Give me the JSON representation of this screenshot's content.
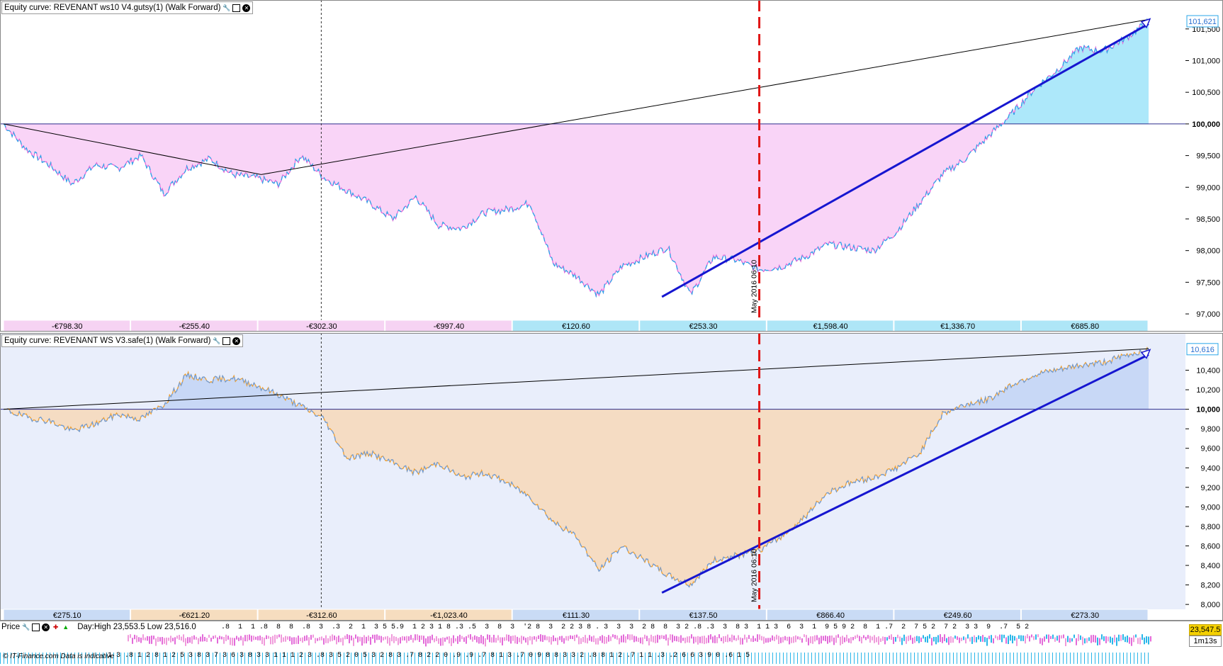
{
  "colors": {
    "upper_pos_fill": "#ade8fa",
    "upper_neg_fill": "#f9d4f7",
    "upper_line": "#2aa7e9",
    "upper_line_neg": "#e36ad9",
    "lower_pos_fill": "#c8d8f6",
    "lower_neg_fill": "#f5dcc3",
    "lower_line": "#6b9cdc",
    "lower_line_neg": "#f0a030",
    "trend_blue": "#1616d0",
    "vline_red": "#e01515",
    "panel_bg": "#ffffff",
    "lower_panel_bg": "#e9eefb"
  },
  "upper_panel": {
    "title": "Equity curve: REVENANT ws10 V4.gutsy(1) (Walk Forward)",
    "icons": [
      "wrench-icon",
      "window-icon",
      "close-icon"
    ],
    "date_label": "May 2016 06:10",
    "current_value_badge": "101,621",
    "segments": [
      {
        "label": "-€798.30",
        "sign": "neg"
      },
      {
        "label": "-€255.40",
        "sign": "neg"
      },
      {
        "label": "-€302.30",
        "sign": "neg"
      },
      {
        "label": "-€997.40",
        "sign": "neg"
      },
      {
        "label": "€120.60",
        "sign": "pos"
      },
      {
        "label": "€253.30",
        "sign": "pos"
      },
      {
        "label": "€1,598.40",
        "sign": "pos"
      },
      {
        "label": "€1,336.70",
        "sign": "pos"
      },
      {
        "label": "€685.80",
        "sign": "pos"
      }
    ]
  },
  "lower_panel": {
    "title": "Equity curve: REVENANT WS V3.safe(1) (Walk Forward)",
    "icons": [
      "wrench-icon",
      "window-icon",
      "close-icon"
    ],
    "date_label": "May 2016 06:10",
    "current_value_badge": "10,616",
    "segments": [
      {
        "label": "€275.10",
        "sign": "pos"
      },
      {
        "label": "-€621.20",
        "sign": "neg"
      },
      {
        "label": "-€312.60",
        "sign": "neg"
      },
      {
        "label": "-€1,023.40",
        "sign": "neg"
      },
      {
        "label": "€111.30",
        "sign": "pos"
      },
      {
        "label": "€137.50",
        "sign": "pos"
      },
      {
        "label": "€866.40",
        "sign": "pos"
      },
      {
        "label": "€249.60",
        "sign": "pos"
      },
      {
        "label": "€273.30",
        "sign": "pos"
      }
    ]
  },
  "price_strip": {
    "label": "Price",
    "info": "Day:High 23,553.5 Low 23,516.0",
    "price": "23,547.5",
    "timer": "1m13s",
    "copyright": "© IT-Finance.com Data is indicative",
    "ticks_row1": "  .8  1  1 .8  8  8  .8  3  .3  2  1  3 5 5.9  1 2 3 1 8 .3 .5  3  8  3  '2 8  3  2 2 3 8 . 3  3  3  2 8  8  3 2 .8 .3  3  8 3  1 1 3  6  3  1  9 5 9 2  8  1 .7  2  7 5 2  7 2  3 3  9  .7  5 2",
    "ticks_row2": "  1 3 .8 1 2 8 1 2 5 3 8 3 7 3 6 3 8 3 3 1 1 1 2 3 .8 3 5 2 0 5 3 2 8 3 .7 8 2 2 0 .9 .9 .7 8 1 3 .7 0 9 8 8 3 3 2 .8 8 1 2 .7 1 1 .3 .2 6 6 3 9 0 .6 1 5"
  },
  "chart_data": [
    {
      "type": "area",
      "title": "Equity curve: REVENANT ws10 V4.gutsy(1) (Walk Forward)",
      "baseline": 100000,
      "ylim": [
        96900,
        101800
      ],
      "y_ticks": [
        97000,
        97500,
        98000,
        98500,
        99000,
        99500,
        100000,
        100500,
        101000,
        101500
      ],
      "y_tick_labels": [
        "97,000",
        "97,500",
        "98,000",
        "98,500",
        "99,000",
        "99,500",
        "100,000",
        "100,500",
        "101,000",
        "101,500"
      ],
      "last_value": 101621,
      "x": [
        0,
        2,
        4,
        6,
        8,
        10,
        12,
        14,
        16,
        18,
        20,
        22,
        24,
        26,
        28,
        30,
        32,
        34,
        36,
        38,
        40,
        42,
        44,
        46,
        48,
        50,
        52,
        54,
        56,
        58,
        60,
        62,
        64,
        66,
        68,
        70,
        72,
        74,
        76,
        78,
        80,
        82,
        84,
        86,
        88,
        90,
        92,
        94,
        96,
        98,
        100
      ],
      "values": [
        100000,
        99600,
        99350,
        99050,
        99350,
        99300,
        99500,
        98900,
        99300,
        99450,
        99200,
        99150,
        99050,
        99500,
        99150,
        98950,
        98750,
        98500,
        98850,
        98400,
        98350,
        98600,
        98650,
        98750,
        97800,
        97600,
        97300,
        97750,
        97900,
        98050,
        97300,
        97900,
        97850,
        97700,
        97750,
        97900,
        98100,
        98050,
        98000,
        98300,
        98750,
        99200,
        99450,
        99800,
        100150,
        100550,
        100850,
        101200,
        101150,
        101350,
        101621
      ],
      "trend_lines": [
        {
          "color": "black",
          "from": [
            0,
            100000
          ],
          "to": [
            22.5,
            99200
          ]
        },
        {
          "color": "black",
          "from": [
            22.5,
            99200
          ],
          "to": [
            100,
            101650
          ]
        },
        {
          "color": "blue",
          "from": [
            57.5,
            97270
          ],
          "to": [
            100,
            101580
          ]
        }
      ],
      "vertical_marker_x": 66
    },
    {
      "type": "area",
      "title": "Equity curve: REVENANT WS V3.safe(1) (Walk Forward)",
      "baseline": 10000,
      "ylim": [
        7950,
        10680
      ],
      "y_ticks": [
        8000,
        8200,
        8400,
        8600,
        8800,
        9000,
        9200,
        9400,
        9600,
        9800,
        10000,
        10200,
        10400
      ],
      "y_tick_labels": [
        "8,000",
        "8,200",
        "8,400",
        "8,600",
        "8,800",
        "9,000",
        "9,200",
        "9,400",
        "9,600",
        "9,800",
        "10,000",
        "10,200",
        "10,400"
      ],
      "last_value": 10616,
      "x": [
        0,
        2,
        4,
        6,
        8,
        10,
        12,
        14,
        16,
        18,
        20,
        22,
        24,
        26,
        28,
        30,
        32,
        34,
        36,
        38,
        40,
        42,
        44,
        46,
        48,
        50,
        52,
        54,
        56,
        58,
        60,
        62,
        64,
        66,
        68,
        70,
        72,
        74,
        76,
        78,
        80,
        82,
        84,
        86,
        88,
        90,
        92,
        94,
        96,
        98,
        100
      ],
      "values": [
        10000,
        9920,
        9880,
        9780,
        9850,
        9950,
        9900,
        10050,
        10350,
        10300,
        10320,
        10250,
        10150,
        10030,
        9900,
        9500,
        9550,
        9450,
        9350,
        9450,
        9300,
        9350,
        9250,
        9100,
        8850,
        8700,
        8350,
        8600,
        8450,
        8300,
        8200,
        8450,
        8500,
        8550,
        8700,
        8900,
        9150,
        9250,
        9300,
        9400,
        9550,
        9950,
        10050,
        10100,
        10250,
        10350,
        10400,
        10450,
        10480,
        10550,
        10616
      ],
      "trend_lines": [
        {
          "color": "black",
          "from": [
            0,
            10000
          ],
          "to": [
            100,
            10620
          ]
        },
        {
          "color": "blue",
          "from": [
            57.5,
            8120
          ],
          "to": [
            100,
            10560
          ]
        }
      ],
      "vertical_marker_x": 66
    }
  ]
}
